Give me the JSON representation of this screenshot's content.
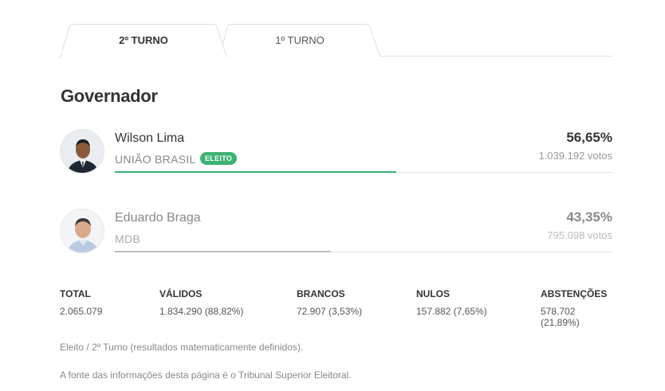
{
  "tabs": [
    {
      "label": "2º TURNO",
      "active": true
    },
    {
      "label": "1º TURNO",
      "active": false
    }
  ],
  "section_title": "Governador",
  "candidates": [
    {
      "name": "Wilson Lima",
      "party": "UNIÃO BRASIL",
      "badge": "ELEITO",
      "percent": "56,65%",
      "votes": "1.039.192 votos",
      "share": 0.5665,
      "bar_color": "#3cb371"
    },
    {
      "name": "Eduardo Braga",
      "party": "MDB",
      "percent": "43,35%",
      "votes": "795.098 votos",
      "share": 0.4335,
      "bar_color": "#bdbdbd"
    }
  ],
  "stats": [
    {
      "label": "TOTAL",
      "value": "2.065.079"
    },
    {
      "label": "VÁLIDOS",
      "value": "1.834.290 (88,82%)"
    },
    {
      "label": "BRANCOS",
      "value": "72.907 (3,53%)"
    },
    {
      "label": "NULOS",
      "value": "157.882 (7,65%)"
    },
    {
      "label": "ABSTENÇÕES",
      "value": "578.702 (21,89%)"
    }
  ],
  "notes": [
    "Eleito / 2º Turno (resultados matematicamente definidos).",
    "A fonte das informações desta página é o Tribunal Superior Eleitoral."
  ],
  "colors": {
    "elected_badge": "#3cb371",
    "winner_bar": "#3cb371",
    "runner_bar": "#bdbdbd"
  },
  "icons": [
    "avatar-wilson-lima",
    "avatar-eduardo-braga"
  ]
}
